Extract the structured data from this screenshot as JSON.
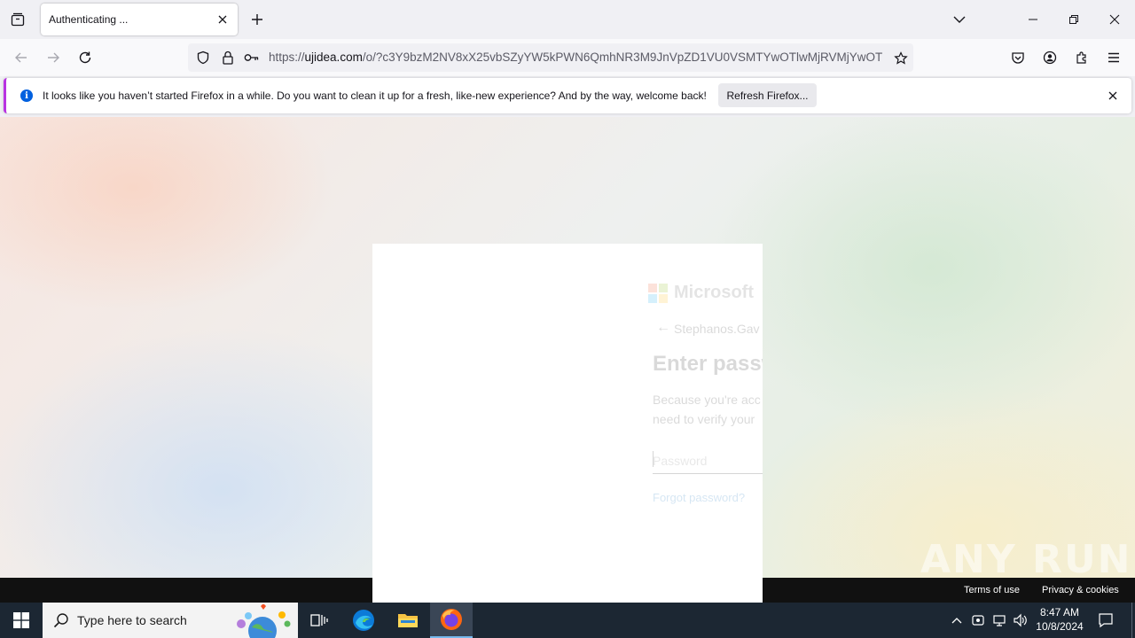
{
  "browser": {
    "tab": {
      "title": "Authenticating ..."
    },
    "url": {
      "scheme": "https://",
      "domain": "ujidea.com",
      "path": "/o/?c3Y9bzM2NV8xX25vbSZyYW5kPWN6QmhNR3M9JnVpZD1VU0VSMTYwOTlwMjRVMjYwOT"
    }
  },
  "notification": {
    "message": "It looks like you haven’t started Firefox in a while. Do you want to clean it up for a fresh, like-new experience? And by the way, welcome back!",
    "button_label": "Refresh Firefox..."
  },
  "login": {
    "brand": "Microsoft",
    "account": "Stephanos.Gav",
    "heading": "Enter passw",
    "description_line1": "Because you're acc",
    "description_line2": "need to verify your",
    "password_placeholder": "Password",
    "forgot_link": "Forgot password?"
  },
  "page_footer": {
    "terms": "Terms of use",
    "privacy": "Privacy & cookies",
    "watermark": "ANY RUN"
  },
  "taskbar": {
    "search_placeholder": "Type here to search",
    "time": "8:47 AM",
    "date": "10/8/2024"
  },
  "colors": {
    "accent": "#0060df",
    "notification_stripe": "#b833e1",
    "taskbar": "#1c2733",
    "ms_red": "#f25022",
    "ms_green": "#7fba00",
    "ms_blue": "#00a4ef",
    "ms_yellow": "#ffb900"
  }
}
